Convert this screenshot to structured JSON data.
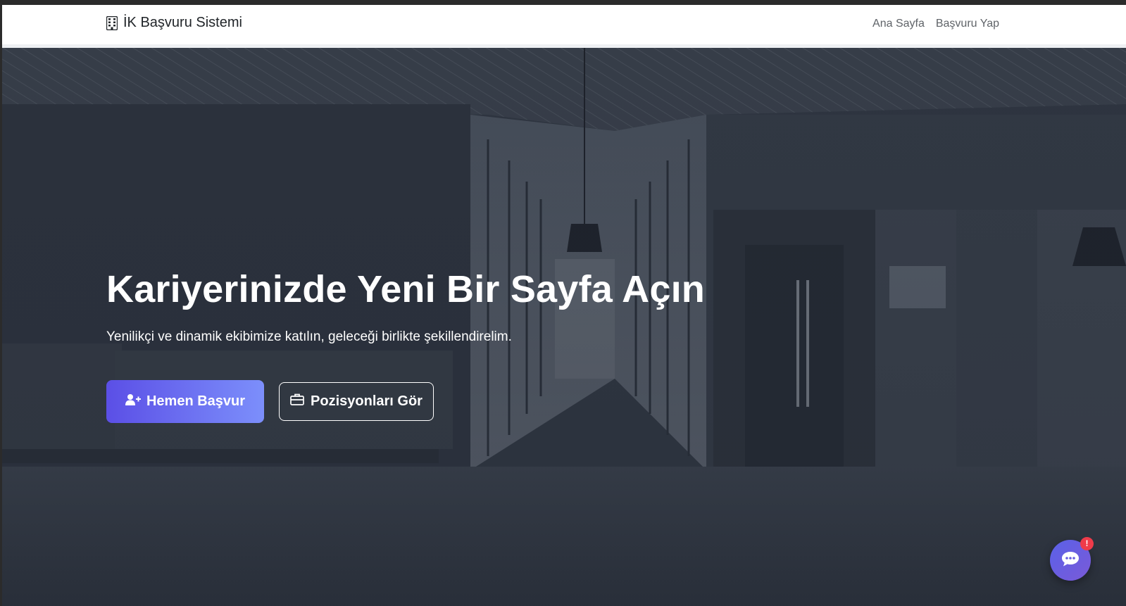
{
  "navbar": {
    "brand_icon": "building-icon",
    "brand_text": "İK Başvuru Sistemi",
    "links": [
      {
        "label": "Ana Sayfa"
      },
      {
        "label": "Başvuru Yap"
      }
    ]
  },
  "hero": {
    "title": "Kariyerinizde Yeni Bir Sayfa Açın",
    "subtitle": "Yenilikçi ve dinamik ekibimize katılın, geleceği birlikte şekillendirelim.",
    "primary_button": {
      "label": "Hemen Başvur",
      "icon": "user-plus-icon"
    },
    "secondary_button": {
      "label": "Pozisyonları Gör",
      "icon": "briefcase-icon"
    },
    "background": "office-corridor-photo"
  },
  "chat_widget": {
    "icon": "chat-bubble-icon",
    "badge": "!"
  },
  "colors": {
    "primary_gradient_start": "#5b4fe6",
    "primary_gradient_end": "#7c8ffb",
    "hero_overlay": "#2c333e",
    "badge": "#ef3b4a"
  }
}
